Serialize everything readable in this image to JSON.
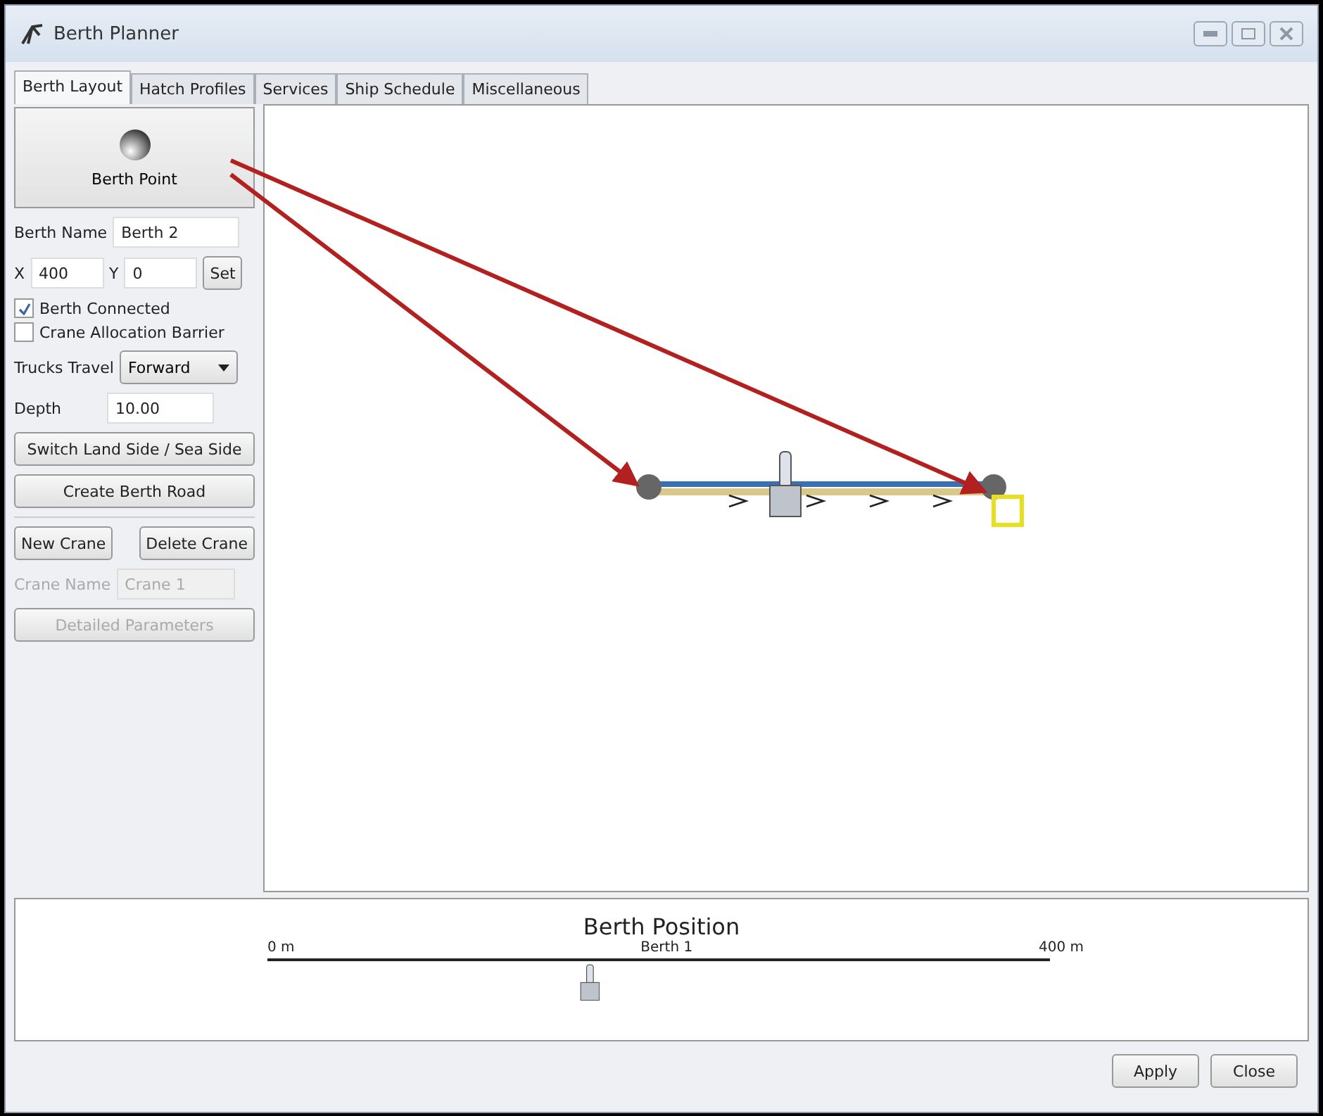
{
  "window": {
    "title": "Berth Planner"
  },
  "tabs": [
    {
      "label": "Berth Layout",
      "selected": true
    },
    {
      "label": "Hatch Profiles",
      "selected": false
    },
    {
      "label": "Services",
      "selected": false
    },
    {
      "label": "Ship Schedule",
      "selected": false
    },
    {
      "label": "Miscellaneous",
      "selected": false
    }
  ],
  "berth_point_button": {
    "label": "Berth Point"
  },
  "berth_name": {
    "label": "Berth Name",
    "value": "Berth 2"
  },
  "x_field": {
    "label": "X",
    "value": "400"
  },
  "y_field": {
    "label": "Y",
    "value": "0"
  },
  "set_button": {
    "label": "Set"
  },
  "checkboxes": [
    {
      "label": "Berth Connected",
      "checked": true
    },
    {
      "label": "Crane Allocation Barrier",
      "checked": false
    }
  ],
  "trucks_travel": {
    "label": "Trucks Travel",
    "value": "Forward"
  },
  "depth": {
    "label": "Depth",
    "value": "10.00"
  },
  "switch_button": {
    "label": "Switch Land Side / Sea Side"
  },
  "road_button": {
    "label": "Create Berth Road"
  },
  "new_crane_button": {
    "label": "New Crane"
  },
  "delete_crane_button": {
    "label": "Delete Crane"
  },
  "crane_name": {
    "label": "Crane Name",
    "value": "Crane 1",
    "disabled": true
  },
  "detailed_parameters_button": {
    "label": "Detailed Parameters",
    "disabled": true
  },
  "berth_position": {
    "title": "Berth Position",
    "start": "0 m",
    "berth": "Berth 1",
    "end": "400 m"
  },
  "footer_buttons": [
    {
      "label": "Apply"
    },
    {
      "label": "Close"
    }
  ]
}
